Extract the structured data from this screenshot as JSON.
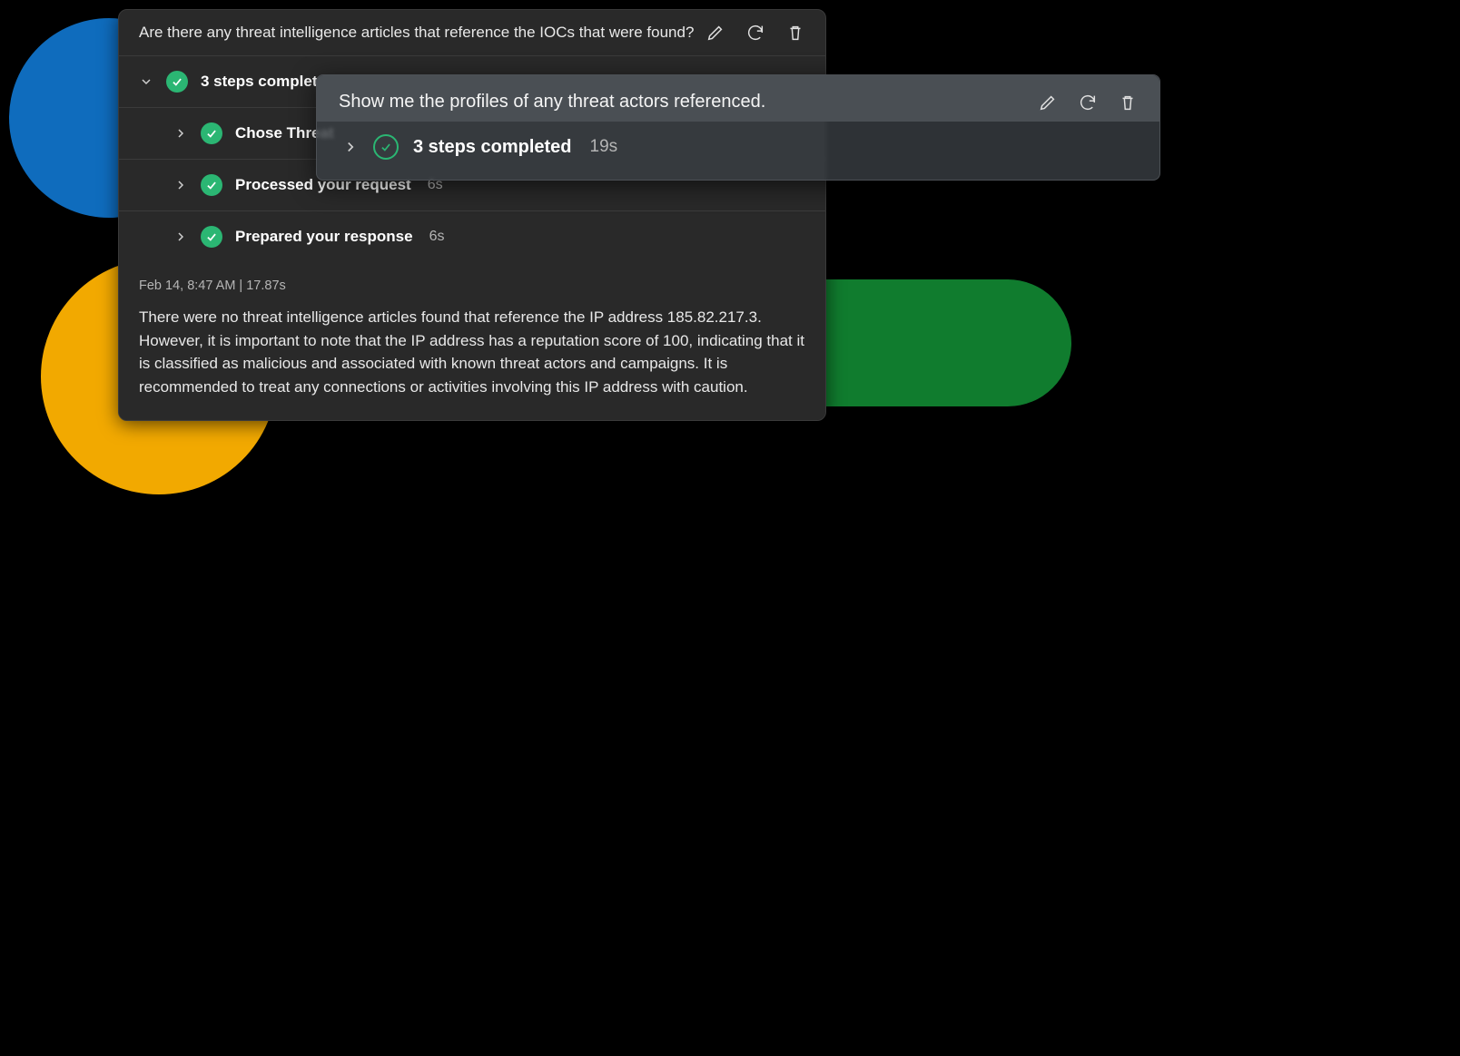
{
  "background_shapes": {
    "blue": "#0f6cbd",
    "yellow": "#f2a900",
    "green": "#107c2e"
  },
  "card": {
    "prompt": "Are there any threat intelligence articles that reference the IOCs that were found?",
    "summary": {
      "label": "3 steps completed"
    },
    "steps": [
      {
        "label": "Chose Threat",
        "time": ""
      },
      {
        "label": "Processed your request",
        "time": "6s"
      },
      {
        "label": "Prepared your response",
        "time": "6s"
      }
    ],
    "timestamp": "Feb 14, 8:47 AM  |  17.87s",
    "response": "There were no threat intelligence articles found that reference the IP address 185.82.217.3. However, it is important to note that the IP address has a reputation score of 100, indicating that it is classified as malicious and associated with known threat actors and campaigns. It is recommended to treat any connections or activities involving this IP address with caution."
  },
  "popup": {
    "prompt": "Show me the profiles of any threat actors referenced.",
    "summary": {
      "label": "3 steps completed",
      "time": "19s"
    }
  },
  "icons": {
    "edit": "edit-icon",
    "refresh": "refresh-icon",
    "delete": "trash-icon",
    "chevron_down": "chevron-down-icon",
    "chevron_right": "chevron-right-icon",
    "check": "check-icon"
  }
}
